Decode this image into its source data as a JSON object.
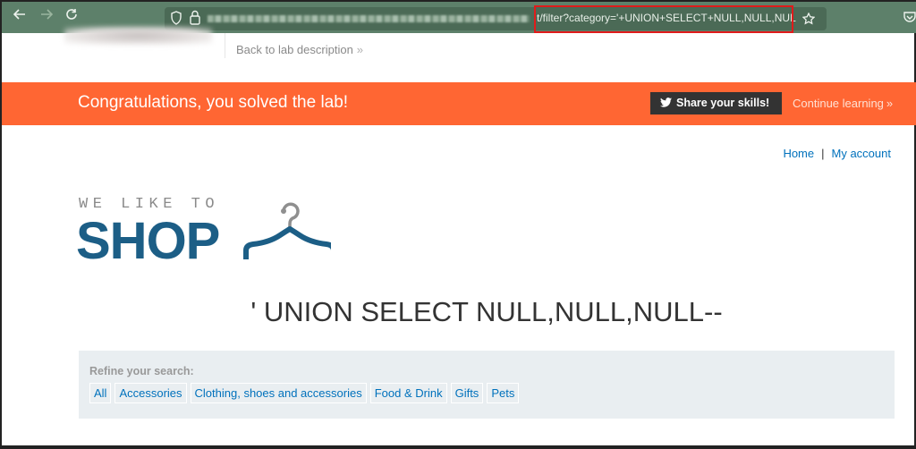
{
  "browser": {
    "url_visible_suffix": "filter?category='+UNION+SELECT+NULL,NULL,NULL--",
    "url_prefix_char": "t/",
    "icons": [
      "back-icon",
      "forward-icon",
      "reload-icon",
      "shield-icon",
      "lock-icon",
      "star-icon",
      "pocket-icon"
    ]
  },
  "header": {
    "back_link": "Back to lab description",
    "back_chevron": "»"
  },
  "banner": {
    "message": "Congratulations, you solved the lab!",
    "share_button": "Share your skills!",
    "continue_link": "Continue learning",
    "continue_chevron": "»",
    "color": "#ff6633"
  },
  "nav": {
    "home": "Home",
    "separator": "|",
    "my_account": "My account"
  },
  "logo": {
    "tagline": "WE LIKE TO",
    "name": "SHOP",
    "color": "#1c5e86"
  },
  "page": {
    "heading": "' UNION SELECT NULL,NULL,NULL--"
  },
  "filter": {
    "label": "Refine your search:",
    "categories": [
      {
        "label": "All"
      },
      {
        "label": "Accessories"
      },
      {
        "label": "Clothing, shoes and accessories"
      },
      {
        "label": "Food & Drink"
      },
      {
        "label": "Gifts"
      },
      {
        "label": "Pets"
      }
    ]
  }
}
